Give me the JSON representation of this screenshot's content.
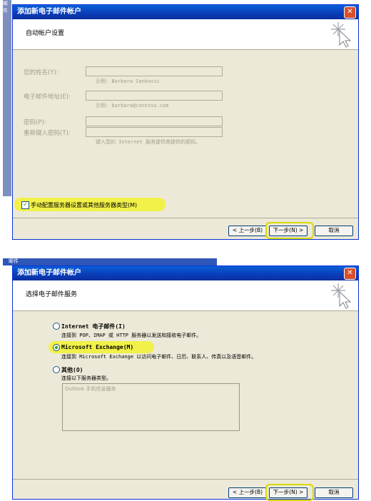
{
  "screen1": {
    "behind_label": "邮件",
    "title": "添加新电子邮件帐户",
    "close_glyph": "✕",
    "header": "自动帐户设置",
    "fields": [
      {
        "label": "您的姓名(Y):",
        "hint": "示例: Barbara Sankovic"
      },
      {
        "label": "电子邮件地址(E):",
        "hint": "示例: barbara@contoso.com"
      },
      {
        "label": "密码(P):",
        "hint": ""
      },
      {
        "label": "重新键入密码(T):",
        "hint": "键入您的 Internet 服务提供商提供的密码。"
      }
    ],
    "manual_checkbox": {
      "label": "手动配置服务器设置或其他服务器类型(M)",
      "checked": true
    },
    "buttons": {
      "back": "< 上一步(B)",
      "next": "下一步(N) >",
      "cancel": "取消"
    }
  },
  "screen2": {
    "behind_label": "邮件",
    "title": "添加新电子邮件帐户",
    "close_glyph": "✕",
    "header": "选择电子邮件服务",
    "options": [
      {
        "label": "Internet 电子邮件(I)",
        "desc": "连接到 POP、IMAP 或 HTTP 服务器以发送和接收电子邮件。",
        "selected": false
      },
      {
        "label": "Microsoft Exchange(M)",
        "desc": "连接到 Microsoft Exchange 以访问电子邮件、日历、联系人、传真以及语音邮件。",
        "selected": true
      },
      {
        "label": "其他(O)",
        "desc": "连接以下服务器类型。",
        "selected": false
      }
    ],
    "other_list": [
      "Outlook 手机信息服务"
    ],
    "buttons": {
      "back": "< 上一步(B)",
      "next": "下一步(N) >",
      "cancel": "取消"
    }
  },
  "colors": {
    "titlebar": "#0a4fd0",
    "highlight": "#f2f23a",
    "dialog_bg": "#ece9d8"
  }
}
